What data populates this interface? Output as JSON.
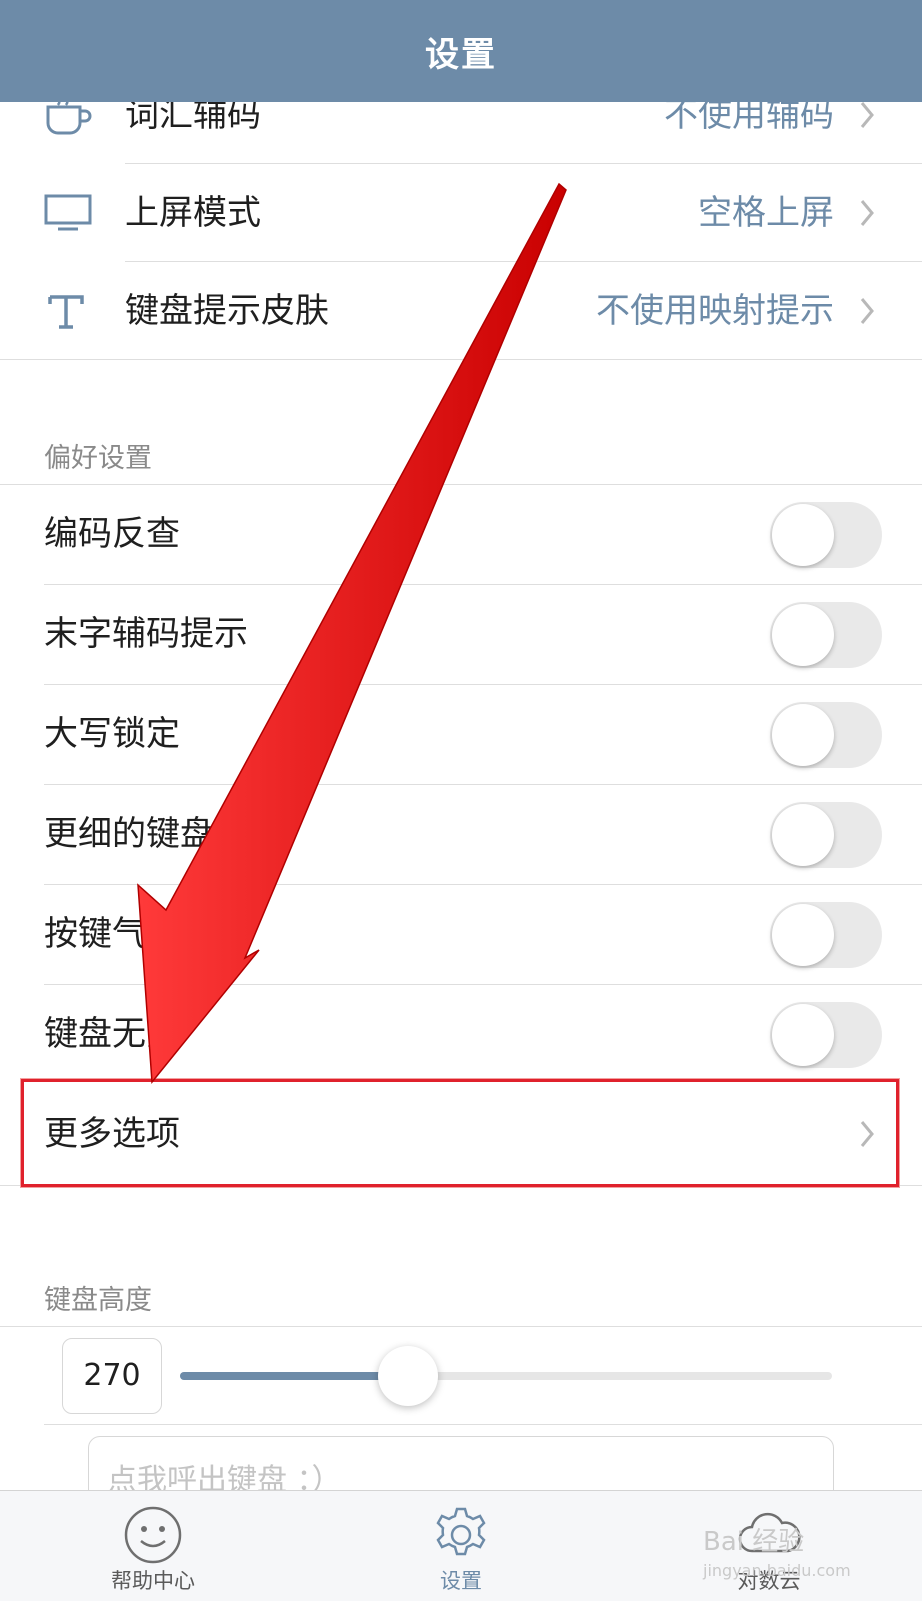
{
  "header": {
    "title": "设置"
  },
  "top_rows": [
    {
      "icon": "cup-icon",
      "label": "词汇辅码",
      "value": "不使用辅码"
    },
    {
      "icon": "monitor-icon",
      "label": "上屏模式",
      "value": "空格上屏"
    },
    {
      "icon": "text-t-icon",
      "label": "键盘提示皮肤",
      "value": "不使用映射提示"
    }
  ],
  "preferences": {
    "title": "偏好设置",
    "items": [
      {
        "label": "编码反查",
        "on": false
      },
      {
        "label": "末字辅码提示",
        "on": false
      },
      {
        "label": "大写锁定",
        "on": false
      },
      {
        "label": "更细的键盘字母",
        "on": false
      },
      {
        "label": "按键气",
        "on": false
      },
      {
        "label": "键盘无刻",
        "on": false
      }
    ],
    "more": {
      "label": "更多选项"
    }
  },
  "keyboard_height": {
    "title": "键盘高度",
    "value": "270",
    "slider_fraction": 0.35,
    "input_placeholder": "点我呼出键盘 ：）"
  },
  "tabbar": {
    "tabs": [
      {
        "icon": "smiley-icon",
        "label": "帮助中心",
        "active": false
      },
      {
        "icon": "gear-icon",
        "label": "设置",
        "active": true
      },
      {
        "icon": "cloud-icon",
        "label": "对数云",
        "active": false
      }
    ]
  },
  "watermark": {
    "text": "Bai 经验",
    "sub": "jingyan.baidu.com"
  },
  "colors": {
    "accent": "#6d8ba8",
    "header": "#6d8ba8",
    "highlight": "#e0212c",
    "arrow": "#ee1111"
  }
}
